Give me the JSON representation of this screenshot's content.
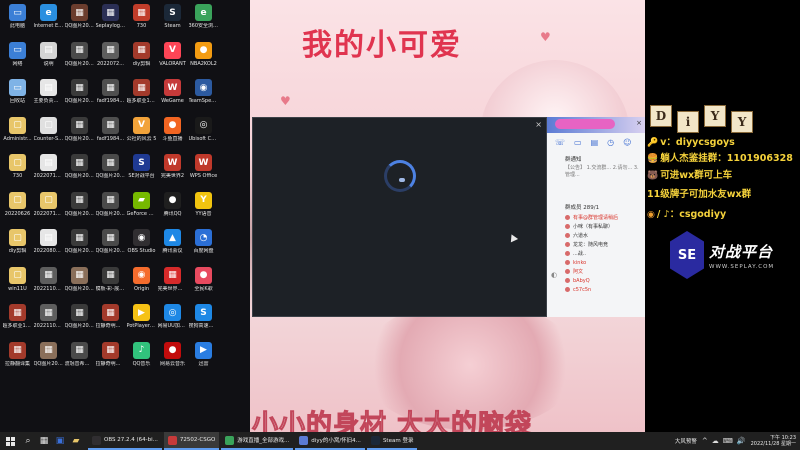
{
  "desktop": {
    "icons": [
      {
        "label": "此电脑",
        "glyph": "▭",
        "color": "#3b7fd6"
      },
      {
        "label": "Internet Explorer",
        "glyph": "e",
        "color": "#2a8fe0"
      },
      {
        "label": "QQ图片20220717...",
        "glyph": "▦",
        "color": "#6b3d2e"
      },
      {
        "label": "Seplaylogo_直播推荐",
        "glyph": "▦",
        "color": "#2b2f55"
      },
      {
        "label": "730",
        "glyph": "▦",
        "color": "#c13d2a"
      },
      {
        "label": "Steam",
        "glyph": "S",
        "color": "#1b2838"
      },
      {
        "label": "360安全浏览器",
        "glyph": "e",
        "color": "#3aa35b"
      },
      {
        "label": "",
        "glyph": "",
        "color": "transparent"
      },
      {
        "label": "网络",
        "glyph": "▭",
        "color": "#3b7fd6"
      },
      {
        "label": "说明",
        "glyph": "▤",
        "color": "#d4d4d4"
      },
      {
        "label": "QQ图片20220714...",
        "glyph": "▦",
        "color": "#4a4a4a"
      },
      {
        "label": "2022072...",
        "glyph": "▦",
        "color": "#5e5e5e"
      },
      {
        "label": "diy剪辑",
        "glyph": "▦",
        "color": "#a33a2b"
      },
      {
        "label": "VALORANT",
        "glyph": "V",
        "color": "#fd4556"
      },
      {
        "label": "NBA2KOL2",
        "glyph": "●",
        "color": "#f39c12"
      },
      {
        "label": "",
        "glyph": "",
        "color": "transparent"
      },
      {
        "label": "回收站",
        "glyph": "▭",
        "color": "#7fb3e6"
      },
      {
        "label": "主要负责人登记表(1)",
        "glyph": "▤",
        "color": "#e6e6e6"
      },
      {
        "label": "QQ图片20220713...",
        "glyph": "▦",
        "color": "#3a3a3a"
      },
      {
        "label": "fadf1984...",
        "glyph": "▦",
        "color": "#4f4f4f"
      },
      {
        "label": "超多职业154懒人包",
        "glyph": "▦",
        "color": "#a33a2b"
      },
      {
        "label": "WeGame",
        "glyph": "W",
        "color": "#c63a3a"
      },
      {
        "label": "TeamSpeak 3",
        "glyph": "◉",
        "color": "#2c5aa0"
      },
      {
        "label": "",
        "glyph": "",
        "color": "transparent"
      },
      {
        "label": "Administr...",
        "glyph": "▢",
        "color": "#e8c66a"
      },
      {
        "label": "Counter-S... Global Off...",
        "glyph": "▢",
        "color": "#e0e0e0"
      },
      {
        "label": "QQ图片20220823...",
        "glyph": "▦",
        "color": "#3a3a3a"
      },
      {
        "label": "fadf1984...",
        "glyph": "▦",
        "color": "#4f4f4f"
      },
      {
        "label": "公社的风云 5",
        "glyph": "V",
        "color": "#f2a33a"
      },
      {
        "label": "斗鱼直播",
        "glyph": "●",
        "color": "#f26522"
      },
      {
        "label": "Ubisoft Connect",
        "glyph": "◎",
        "color": "#1a1a1a"
      },
      {
        "label": "",
        "glyph": "",
        "color": "transparent"
      },
      {
        "label": "730",
        "glyph": "▢",
        "color": "#e8c66a"
      },
      {
        "label": "20220711...",
        "glyph": "▤",
        "color": "#e6e6e6"
      },
      {
        "label": "QQ图片20220906...",
        "glyph": "▦",
        "color": "#3a3a3a"
      },
      {
        "label": "QQ图片20220712...",
        "glyph": "▦",
        "color": "#4a4a4a"
      },
      {
        "label": "SE对战平台",
        "glyph": "S",
        "color": "#1f3a93"
      },
      {
        "label": "完美世界2",
        "glyph": "W",
        "color": "#c0392b"
      },
      {
        "label": "WPS Office",
        "glyph": "W",
        "color": "#c0392b"
      },
      {
        "label": "",
        "glyph": "",
        "color": "transparent"
      },
      {
        "label": "20220626",
        "glyph": "▢",
        "color": "#e8c66a"
      },
      {
        "label": "20220711...",
        "glyph": "▢",
        "color": "#e8c66a"
      },
      {
        "label": "QQ图片20220906...",
        "glyph": "▦",
        "color": "#3a3a3a"
      },
      {
        "label": "QQ图片20220712...",
        "glyph": "▦",
        "color": "#4a4a4a"
      },
      {
        "label": "GeForce Experience",
        "glyph": "▰",
        "color": "#76b900"
      },
      {
        "label": "腾讯QQ",
        "glyph": "●",
        "color": "#1f1f1f"
      },
      {
        "label": "YY语音",
        "glyph": "Y",
        "color": "#f1c40f"
      },
      {
        "label": "",
        "glyph": "",
        "color": "transparent"
      },
      {
        "label": "diy剪辑",
        "glyph": "▢",
        "color": "#e8c66a"
      },
      {
        "label": "20220804...",
        "glyph": "▤",
        "color": "#e6e6e6"
      },
      {
        "label": "QQ图片20220906...",
        "glyph": "▦",
        "color": "#3a3a3a"
      },
      {
        "label": "QQ图片20220712...",
        "glyph": "▦",
        "color": "#4a4a4a"
      },
      {
        "label": "OBS Studio",
        "glyph": "◉",
        "color": "#302e31"
      },
      {
        "label": "腾讯会议",
        "glyph": "▲",
        "color": "#1e88e5"
      },
      {
        "label": "百度网盘",
        "glyph": "◔",
        "color": "#2b6fd6"
      },
      {
        "label": "",
        "glyph": "",
        "color": "transparent"
      },
      {
        "label": "win11U",
        "glyph": "▢",
        "color": "#e8c66a"
      },
      {
        "label": "20221104...",
        "glyph": "▦",
        "color": "#5e5e5e"
      },
      {
        "label": "QQ图片20221021...",
        "glyph": "▦",
        "color": "#8a6f5a"
      },
      {
        "label": "模板-彩-展出(1)",
        "glyph": "▦",
        "color": "#3a3a3a"
      },
      {
        "label": "Origin",
        "glyph": "◉",
        "color": "#f56c2d"
      },
      {
        "label": "完美世界竞技平台",
        "glyph": "▦",
        "color": "#d62a2a"
      },
      {
        "label": "全民K歌",
        "glyph": "●",
        "color": "#e84a5f"
      },
      {
        "label": "",
        "glyph": "",
        "color": "transparent"
      },
      {
        "label": "超多职业154懒人包",
        "glyph": "▦",
        "color": "#a33a2b"
      },
      {
        "label": "20221107...",
        "glyph": "▦",
        "color": "#5e5e5e"
      },
      {
        "label": "QQ图片20221107...",
        "glyph": "▦",
        "color": "#3a3a3a"
      },
      {
        "label": "拉静奇明晨风集...",
        "glyph": "▦",
        "color": "#a33a2b"
      },
      {
        "label": "PotPlayer 64 bit",
        "glyph": "▶",
        "color": "#f6c215"
      },
      {
        "label": "网易UU加速器",
        "glyph": "◎",
        "color": "#1e88e5"
      },
      {
        "label": "搜狗高速浏览器",
        "glyph": "S",
        "color": "#1e88e5"
      },
      {
        "label": "",
        "glyph": "",
        "color": "transparent"
      },
      {
        "label": "拉静翻译集",
        "glyph": "▦",
        "color": "#a33a2b"
      },
      {
        "label": "QQ图片20220625...",
        "glyph": "▦",
        "color": "#8a6f5a"
      },
      {
        "label": "流氓音希望电视...",
        "glyph": "▦",
        "color": "#4a4a4a"
      },
      {
        "label": "拉静奇明晨风集...",
        "glyph": "▦",
        "color": "#a33a2b"
      },
      {
        "label": "QQ音乐",
        "glyph": "♪",
        "color": "#31c27c"
      },
      {
        "label": "网易云音乐",
        "glyph": "●",
        "color": "#c20c0c"
      },
      {
        "label": "迅雷",
        "glyph": "▶",
        "color": "#2a7de1"
      },
      {
        "label": "",
        "glyph": "",
        "color": "transparent"
      }
    ],
    "extra_icons": [
      {
        "label": "",
        "glyph": "",
        "color": "#3a6fd8"
      }
    ]
  },
  "stream": {
    "title": "我的小可爱",
    "caption": "小小的身材 大大的脑袋"
  },
  "loader": {
    "close_glyph": "×"
  },
  "qq": {
    "close_glyph": "×",
    "toolbar_icons": [
      "☏",
      "▭",
      "▤",
      "◷",
      "☺"
    ],
    "announce_title": "群通知",
    "announce_body": "【公告】 1.交流群... 2.请勿... 3.管理...",
    "members_head": "群成员 289/1",
    "members": [
      {
        "name": "有事@群管理请稍后",
        "red": true
      },
      {
        "name": "小咪（有事私聊）",
        "red": false
      },
      {
        "name": "六道水",
        "red": false
      },
      {
        "name": "龙龙：随风电竞",
        "red": false
      },
      {
        "name": "...战..",
        "red": false
      },
      {
        "name": "kinko",
        "red": true
      },
      {
        "name": "阿文",
        "red": true
      },
      {
        "name": "bAbyQ",
        "red": true
      },
      {
        "name": "c57c5n",
        "red": true
      }
    ],
    "side_glyph": "◐"
  },
  "streamer": {
    "tiles": [
      "D",
      "i",
      "Y",
      "Y"
    ],
    "lines": [
      {
        "icon": "🔑",
        "text": "v：diyycsgoys"
      },
      {
        "icon": "🍔",
        "text": "躺人杰鉴挂群：1101906328"
      },
      {
        "icon": "🐻",
        "text": "可进wx群可上车"
      },
      {
        "icon": "",
        "text": "11级牌子可加水友wx群"
      },
      {
        "icon": "◉",
        "text": "/ ♪：csgodiyy"
      }
    ],
    "logo": "SE",
    "brand": "对战平台",
    "url": "WWW.SEPLAY.COM"
  },
  "taskbar": {
    "pinned": [
      {
        "glyph": "⌕",
        "color": "#e8e8e8"
      },
      {
        "glyph": "▦",
        "color": "#e8e8e8"
      },
      {
        "glyph": "▣",
        "color": "#3a6fd8"
      },
      {
        "glyph": "▰",
        "color": "#e8c66a"
      }
    ],
    "apps": [
      {
        "label": "OBS 27.2.4 (64-bi...",
        "color": "#302e31",
        "active": false
      },
      {
        "label": "72502-CSGO",
        "color": "#c63a3a",
        "active": true
      },
      {
        "label": "游戏直播_全部游戏...",
        "color": "#3aa35b",
        "active": false
      },
      {
        "label": "diyy的小窝/怀旧4...",
        "color": "#5b7bd4",
        "active": false
      },
      {
        "label": "Steam 登录",
        "color": "#1b2838",
        "active": false
      }
    ],
    "tray_text": "大风预警",
    "tray_icons": [
      "^",
      "☁",
      "⌨",
      "🔊"
    ],
    "time": "下午 10:23",
    "date": "2022/11/28 星期一"
  }
}
